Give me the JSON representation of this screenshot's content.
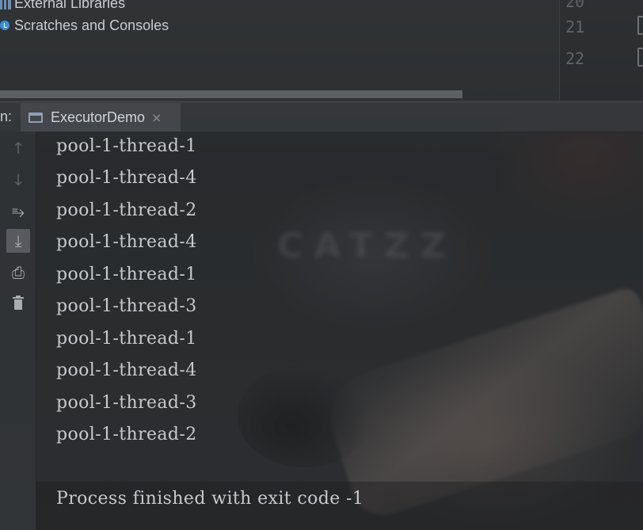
{
  "project_tree": {
    "items": [
      {
        "label": "External Libraries",
        "icon": "library-icon"
      },
      {
        "label": "Scratches and Consoles",
        "icon": "scratches-icon"
      }
    ]
  },
  "editor_gutter": {
    "line_numbers": [
      "21",
      "22"
    ]
  },
  "run_window": {
    "prefix": "n:",
    "tab": {
      "label": "ExecutorDemo",
      "close": "×"
    }
  },
  "toolbar": {
    "buttons": [
      {
        "name": "up-arrow-icon",
        "glyph": "↑"
      },
      {
        "name": "down-arrow-icon",
        "glyph": "↓"
      },
      {
        "name": "soft-wrap-icon",
        "glyph": "⥱"
      },
      {
        "name": "scroll-to-end-icon",
        "glyph": "⤓"
      },
      {
        "name": "print-icon",
        "glyph": "⎙"
      },
      {
        "name": "trash-icon",
        "glyph": "🗑"
      }
    ]
  },
  "console": {
    "lines": [
      "pool-1-thread-1",
      "pool-1-thread-4",
      "pool-1-thread-2",
      "pool-1-thread-4",
      "pool-1-thread-1",
      "pool-1-thread-3",
      "pool-1-thread-1",
      "pool-1-thread-4",
      "pool-1-thread-3",
      "pool-1-thread-2"
    ],
    "exit_message": "Process finished with exit code -1"
  },
  "wallpaper_text": "CATZZ"
}
